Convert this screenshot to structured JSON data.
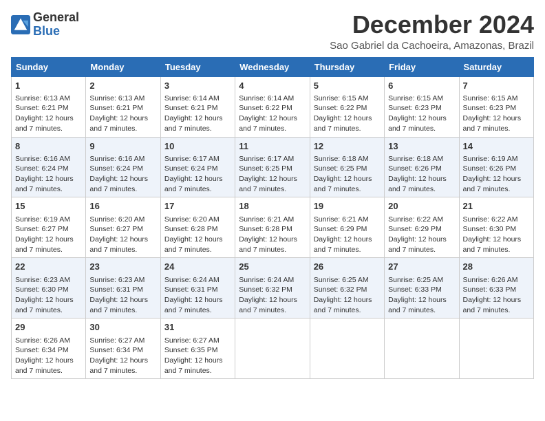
{
  "logo": {
    "line1": "General",
    "line2": "Blue"
  },
  "title": "December 2024",
  "location": "Sao Gabriel da Cachoeira, Amazonas, Brazil",
  "days_of_week": [
    "Sunday",
    "Monday",
    "Tuesday",
    "Wednesday",
    "Thursday",
    "Friday",
    "Saturday"
  ],
  "weeks": [
    [
      {
        "day": "1",
        "sunrise": "6:13 AM",
        "sunset": "6:21 PM",
        "daylight": "12 hours and 7 minutes."
      },
      {
        "day": "2",
        "sunrise": "6:13 AM",
        "sunset": "6:21 PM",
        "daylight": "12 hours and 7 minutes."
      },
      {
        "day": "3",
        "sunrise": "6:14 AM",
        "sunset": "6:21 PM",
        "daylight": "12 hours and 7 minutes."
      },
      {
        "day": "4",
        "sunrise": "6:14 AM",
        "sunset": "6:22 PM",
        "daylight": "12 hours and 7 minutes."
      },
      {
        "day": "5",
        "sunrise": "6:15 AM",
        "sunset": "6:22 PM",
        "daylight": "12 hours and 7 minutes."
      },
      {
        "day": "6",
        "sunrise": "6:15 AM",
        "sunset": "6:23 PM",
        "daylight": "12 hours and 7 minutes."
      },
      {
        "day": "7",
        "sunrise": "6:15 AM",
        "sunset": "6:23 PM",
        "daylight": "12 hours and 7 minutes."
      }
    ],
    [
      {
        "day": "8",
        "sunrise": "6:16 AM",
        "sunset": "6:24 PM",
        "daylight": "12 hours and 7 minutes."
      },
      {
        "day": "9",
        "sunrise": "6:16 AM",
        "sunset": "6:24 PM",
        "daylight": "12 hours and 7 minutes."
      },
      {
        "day": "10",
        "sunrise": "6:17 AM",
        "sunset": "6:24 PM",
        "daylight": "12 hours and 7 minutes."
      },
      {
        "day": "11",
        "sunrise": "6:17 AM",
        "sunset": "6:25 PM",
        "daylight": "12 hours and 7 minutes."
      },
      {
        "day": "12",
        "sunrise": "6:18 AM",
        "sunset": "6:25 PM",
        "daylight": "12 hours and 7 minutes."
      },
      {
        "day": "13",
        "sunrise": "6:18 AM",
        "sunset": "6:26 PM",
        "daylight": "12 hours and 7 minutes."
      },
      {
        "day": "14",
        "sunrise": "6:19 AM",
        "sunset": "6:26 PM",
        "daylight": "12 hours and 7 minutes."
      }
    ],
    [
      {
        "day": "15",
        "sunrise": "6:19 AM",
        "sunset": "6:27 PM",
        "daylight": "12 hours and 7 minutes."
      },
      {
        "day": "16",
        "sunrise": "6:20 AM",
        "sunset": "6:27 PM",
        "daylight": "12 hours and 7 minutes."
      },
      {
        "day": "17",
        "sunrise": "6:20 AM",
        "sunset": "6:28 PM",
        "daylight": "12 hours and 7 minutes."
      },
      {
        "day": "18",
        "sunrise": "6:21 AM",
        "sunset": "6:28 PM",
        "daylight": "12 hours and 7 minutes."
      },
      {
        "day": "19",
        "sunrise": "6:21 AM",
        "sunset": "6:29 PM",
        "daylight": "12 hours and 7 minutes."
      },
      {
        "day": "20",
        "sunrise": "6:22 AM",
        "sunset": "6:29 PM",
        "daylight": "12 hours and 7 minutes."
      },
      {
        "day": "21",
        "sunrise": "6:22 AM",
        "sunset": "6:30 PM",
        "daylight": "12 hours and 7 minutes."
      }
    ],
    [
      {
        "day": "22",
        "sunrise": "6:23 AM",
        "sunset": "6:30 PM",
        "daylight": "12 hours and 7 minutes."
      },
      {
        "day": "23",
        "sunrise": "6:23 AM",
        "sunset": "6:31 PM",
        "daylight": "12 hours and 7 minutes."
      },
      {
        "day": "24",
        "sunrise": "6:24 AM",
        "sunset": "6:31 PM",
        "daylight": "12 hours and 7 minutes."
      },
      {
        "day": "25",
        "sunrise": "6:24 AM",
        "sunset": "6:32 PM",
        "daylight": "12 hours and 7 minutes."
      },
      {
        "day": "26",
        "sunrise": "6:25 AM",
        "sunset": "6:32 PM",
        "daylight": "12 hours and 7 minutes."
      },
      {
        "day": "27",
        "sunrise": "6:25 AM",
        "sunset": "6:33 PM",
        "daylight": "12 hours and 7 minutes."
      },
      {
        "day": "28",
        "sunrise": "6:26 AM",
        "sunset": "6:33 PM",
        "daylight": "12 hours and 7 minutes."
      }
    ],
    [
      {
        "day": "29",
        "sunrise": "6:26 AM",
        "sunset": "6:34 PM",
        "daylight": "12 hours and 7 minutes."
      },
      {
        "day": "30",
        "sunrise": "6:27 AM",
        "sunset": "6:34 PM",
        "daylight": "12 hours and 7 minutes."
      },
      {
        "day": "31",
        "sunrise": "6:27 AM",
        "sunset": "6:35 PM",
        "daylight": "12 hours and 7 minutes."
      },
      null,
      null,
      null,
      null
    ]
  ]
}
